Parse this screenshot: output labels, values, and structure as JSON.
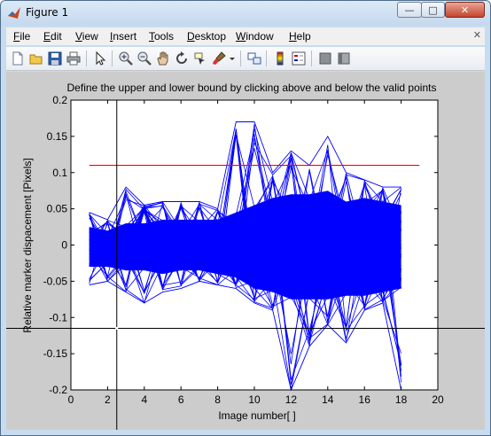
{
  "window": {
    "title": "Figure 1",
    "minimize_glyph": "—",
    "maximize_glyph": "□",
    "close_glyph": "✕"
  },
  "menu": {
    "items": [
      {
        "label": "File",
        "accel": "F",
        "rest": "ile"
      },
      {
        "label": "Edit",
        "accel": "E",
        "rest": "dit"
      },
      {
        "label": "View",
        "accel": "V",
        "rest": "iew"
      },
      {
        "label": "Insert",
        "accel": "I",
        "rest": "nsert"
      },
      {
        "label": "Tools",
        "accel": "T",
        "rest": "ools"
      },
      {
        "label": "Desktop",
        "accel": "D",
        "rest": "esktop"
      },
      {
        "label": "Window",
        "accel": "W",
        "rest": "indow"
      },
      {
        "label": "Help",
        "accel": "H",
        "rest": "elp"
      }
    ],
    "close_glyph": "✕"
  },
  "toolbar": {
    "icons": [
      "new-file-icon",
      "open-file-icon",
      "save-icon",
      "print-icon",
      "edit-plot-arrow-icon",
      "zoom-in-icon",
      "zoom-out-icon",
      "pan-hand-icon",
      "rotate-3d-icon",
      "data-cursor-icon",
      "brush-icon",
      "brush-dropdown-icon",
      "link-plot-icon",
      "colorbar-icon",
      "legend-icon",
      "hide-plot-tools-icon",
      "show-plot-tools-icon"
    ]
  },
  "chart_data": {
    "type": "line",
    "title": "Define the upper and lower bound by clicking above and below the valid points",
    "xlabel": "Image number[ ]",
    "ylabel": "Relative marker dispacement [Pixels]",
    "xlim": [
      0,
      20
    ],
    "ylim": [
      -0.2,
      0.2
    ],
    "xticks": [
      0,
      2,
      4,
      6,
      8,
      10,
      12,
      14,
      16,
      18,
      20
    ],
    "yticks": [
      0.2,
      0.15,
      0.1,
      0.05,
      0,
      -0.05,
      -0.1,
      -0.15,
      -0.2
    ],
    "ytick_labels": [
      "0.2",
      "0.15",
      "0.1",
      "0.05",
      "0",
      "-0.05",
      "-0.1",
      "-0.15",
      "-0.2"
    ],
    "grid": false,
    "series_color": "#0000ff",
    "upper_bound": {
      "x": [
        1,
        19
      ],
      "y": 0.11,
      "color": "#ff0000"
    },
    "crosshair": {
      "x": 2.5,
      "y": -0.115,
      "color": "#000000"
    },
    "envelope": {
      "x": [
        1,
        2,
        3,
        4,
        5,
        6,
        7,
        8,
        9,
        10,
        11,
        12,
        13,
        14,
        15,
        16,
        17,
        18
      ],
      "upper": [
        0.045,
        0.035,
        0.08,
        0.055,
        0.06,
        0.06,
        0.06,
        0.05,
        0.17,
        0.17,
        0.1,
        0.13,
        0.11,
        0.15,
        0.1,
        0.09,
        0.08,
        0.08
      ],
      "lower": [
        -0.055,
        -0.05,
        -0.065,
        -0.08,
        -0.065,
        -0.06,
        -0.05,
        -0.055,
        -0.06,
        -0.08,
        -0.09,
        -0.2,
        -0.14,
        -0.11,
        -0.135,
        -0.09,
        -0.08,
        -0.2
      ],
      "core_upper": [
        0.025,
        0.02,
        0.03,
        0.03,
        0.035,
        0.035,
        0.035,
        0.035,
        0.045,
        0.055,
        0.065,
        0.07,
        0.07,
        0.075,
        0.06,
        0.065,
        0.06,
        0.055
      ],
      "core_lower": [
        -0.03,
        -0.03,
        -0.035,
        -0.035,
        -0.04,
        -0.035,
        -0.035,
        -0.04,
        -0.045,
        -0.06,
        -0.065,
        -0.075,
        -0.075,
        -0.075,
        -0.07,
        -0.07,
        -0.065,
        -0.06
      ]
    }
  }
}
